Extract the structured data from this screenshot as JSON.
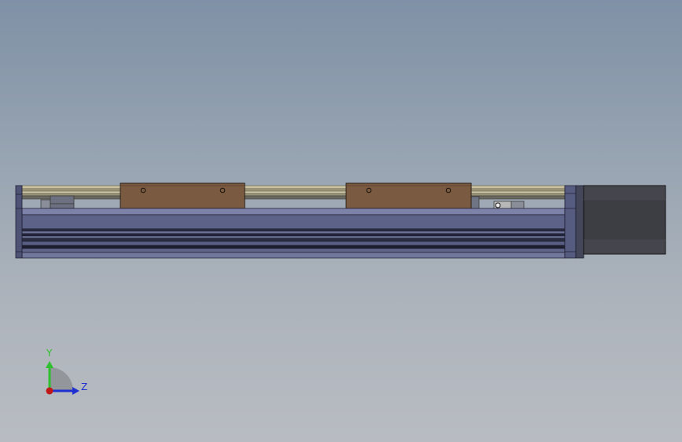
{
  "triad": {
    "y_label": "Y",
    "z_label": "Z",
    "colors": {
      "y": "#2fbf2f",
      "z": "#1f2fd0",
      "x": "#c01818"
    }
  },
  "colors": {
    "background_top": "#7f91a6",
    "background_bottom": "#b8bcc2",
    "carriage": "#7a5a40",
    "base": "#5e6388",
    "rail": "#b8b08c",
    "motor": "#3d3d44"
  }
}
